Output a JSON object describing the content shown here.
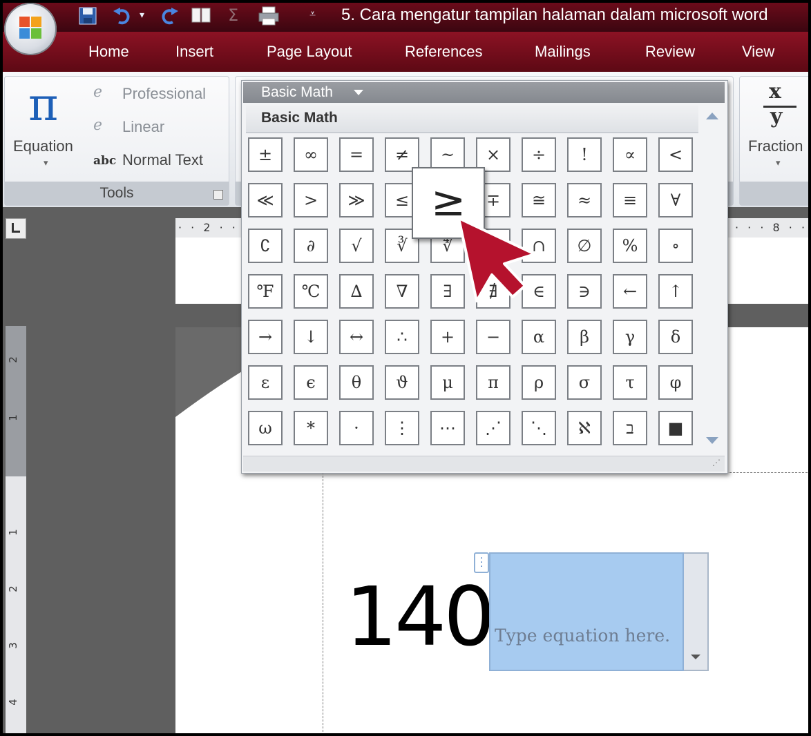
{
  "window": {
    "title": "5. Cara mengatur tampilan halaman dalam microsoft word"
  },
  "tabs": [
    "Home",
    "Insert",
    "Page Layout",
    "References",
    "Mailings",
    "Review",
    "View"
  ],
  "tools_group": {
    "equation_label": "Equation",
    "professional_label": "Professional",
    "linear_label": "Linear",
    "normal_text_label": "Normal Text",
    "group_label": "Tools"
  },
  "structures": {
    "fraction_label": "Fraction",
    "fraction_num": "x",
    "fraction_den": "y"
  },
  "gallery": {
    "dropdown_label": "Basic Math",
    "category_label": "Basic Math",
    "symbols": [
      "±",
      "∞",
      "=",
      "≠",
      "~",
      "×",
      "÷",
      "!",
      "∝",
      "<",
      "≪",
      ">",
      "≫",
      "≤",
      "≥",
      "∓",
      "≅",
      "≈",
      "≡",
      "∀",
      "∁",
      "∂",
      "√",
      "∛",
      "∜",
      "∪",
      "∩",
      "∅",
      "%",
      "∘",
      "℉",
      "℃",
      "∆",
      "∇",
      "∃",
      "∄",
      "∈",
      "∋",
      "←",
      "↑",
      "→",
      "↓",
      "↔",
      "∴",
      "+",
      "−",
      "α",
      "β",
      "γ",
      "δ",
      "ε",
      "ϵ",
      "θ",
      "ϑ",
      "μ",
      "π",
      "ρ",
      "σ",
      "τ",
      "φ",
      "ω",
      "*",
      "·",
      "⋮",
      "⋯",
      "⋰",
      "⋱",
      "ℵ",
      "ב",
      "■"
    ],
    "hovered_symbol": "≥"
  },
  "document": {
    "number_text": "140",
    "equation_placeholder": "Type equation here."
  },
  "ruler": {
    "h_left": "2",
    "h_right": "8",
    "v_nums": [
      "2",
      "1",
      "1",
      "2",
      "3",
      "4"
    ]
  },
  "colors": {
    "titlebar": "#6b0b1a",
    "tabbar": "#8c1224",
    "equation_highlight": "#a7cbf0",
    "cursor": "#b5122d"
  }
}
